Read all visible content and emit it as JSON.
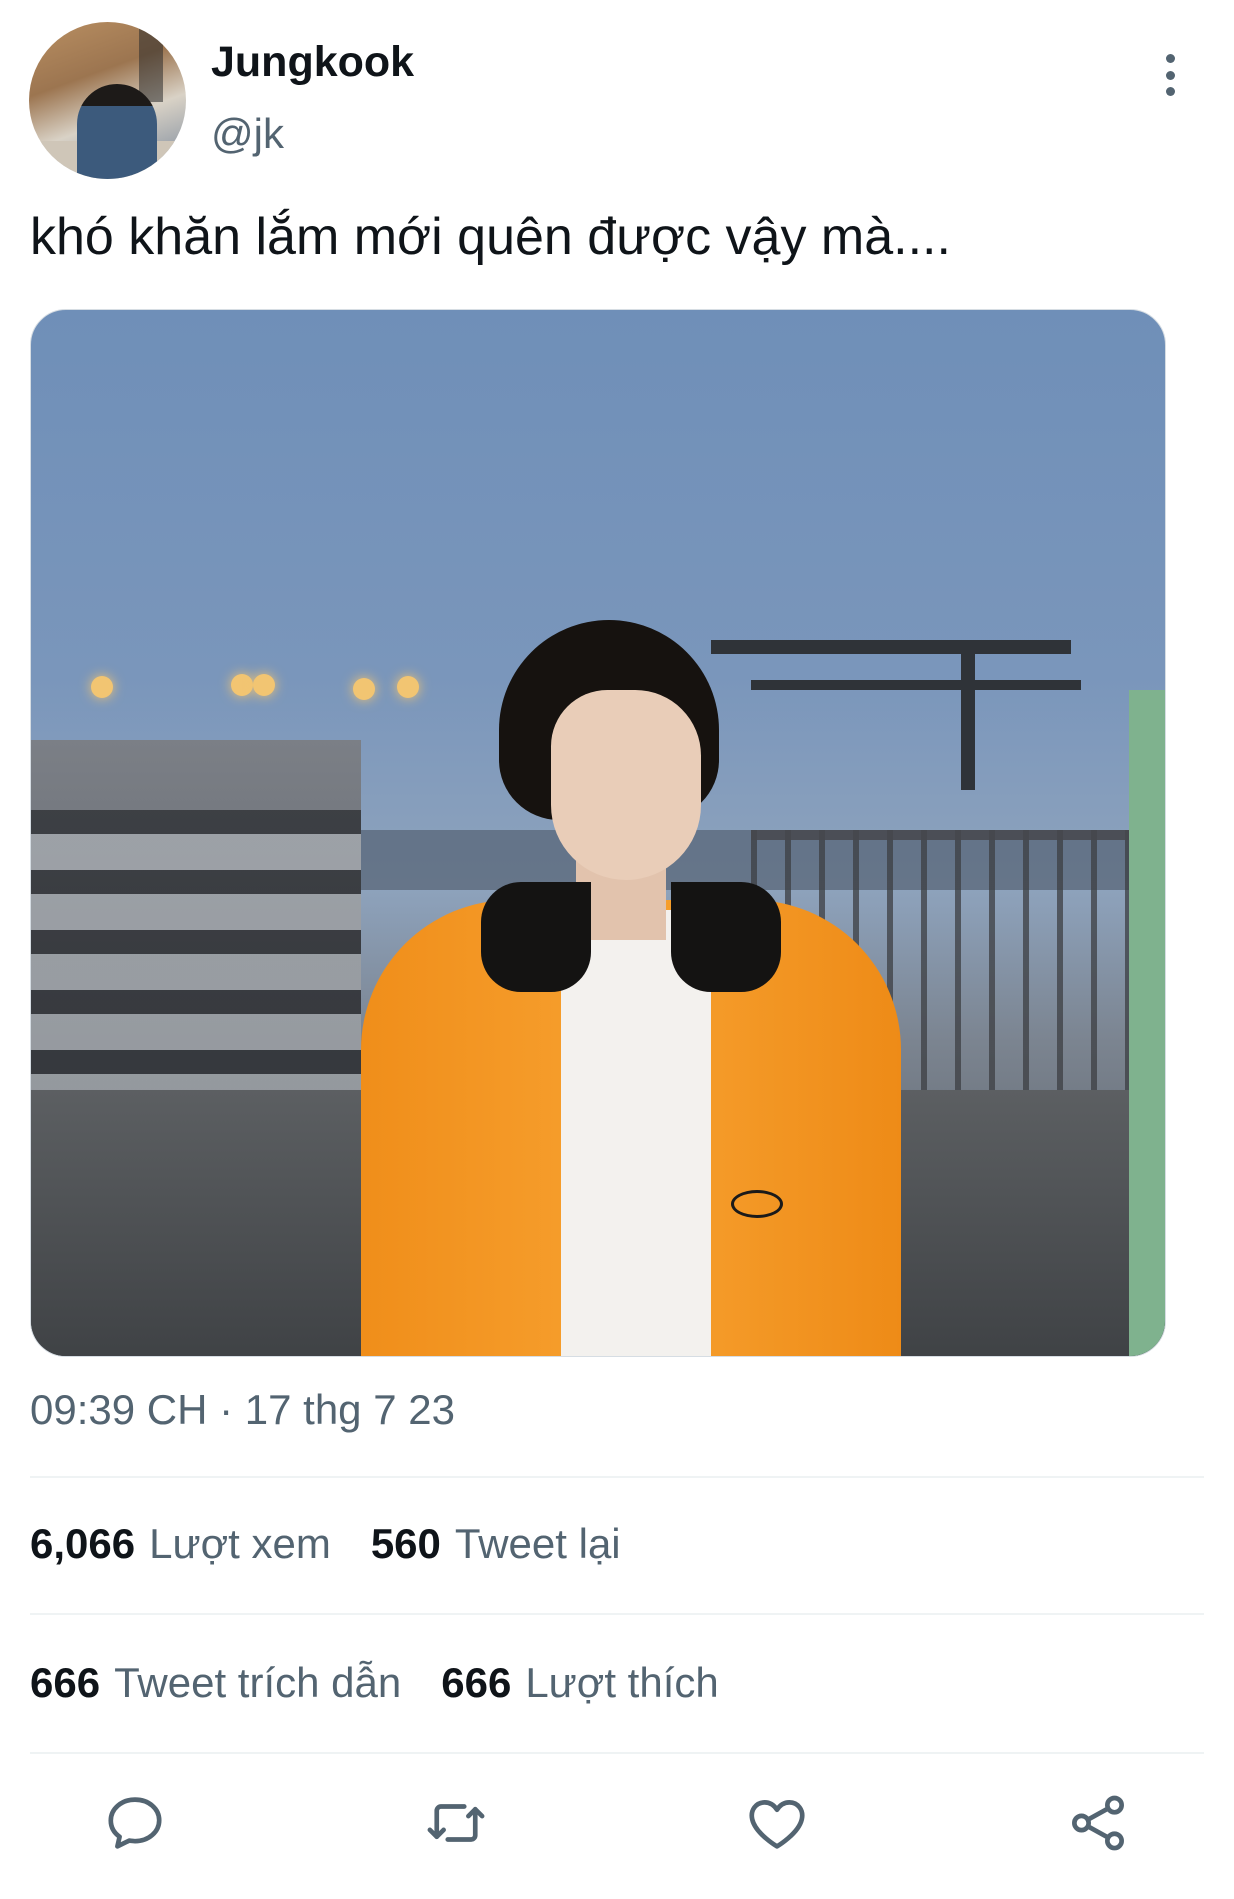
{
  "author": {
    "display_name": "Jungkook",
    "handle": "@jk"
  },
  "tweet": {
    "text": "khó khăn lắm mới quên được vậy mà....",
    "timestamp": "09:39 CH · 17 thg 7 23"
  },
  "stats": {
    "views": {
      "count": "6,066",
      "label": "Lượt xem"
    },
    "retweets": {
      "count": "560",
      "label": "Tweet lại"
    },
    "quotes": {
      "count": "666",
      "label": "Tweet trích dẫn"
    },
    "likes": {
      "count": "666",
      "label": "Lượt thích"
    }
  },
  "actions": {
    "icons": [
      "reply-icon",
      "retweet-icon",
      "like-icon",
      "share-icon"
    ]
  },
  "colors": {
    "text_primary": "#0f1419",
    "text_secondary": "#536471",
    "divider": "#eff3f4"
  }
}
